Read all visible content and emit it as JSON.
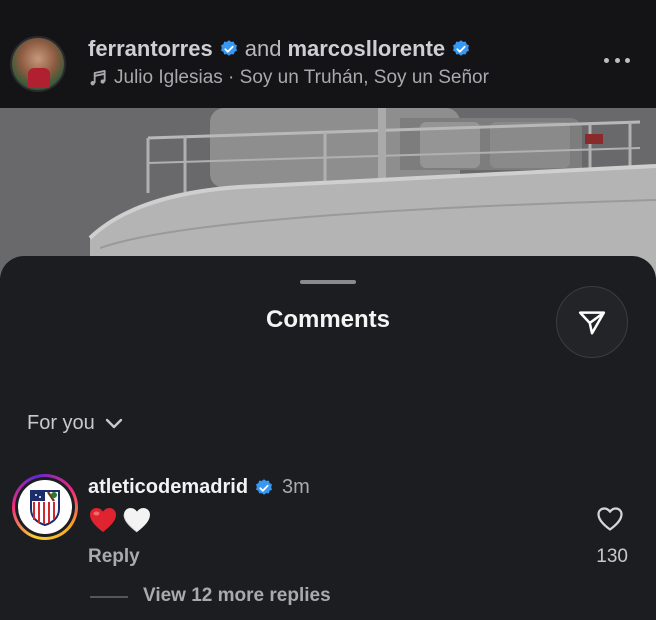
{
  "post": {
    "author1": "ferrantorres",
    "connector": "and",
    "author2": "marcosllorente",
    "music": "Julio Iglesias · Soy un Truhán, Soy un Señor"
  },
  "comments_sheet": {
    "title": "Comments",
    "filter_label": "For you"
  },
  "comments": [
    {
      "username": "atleticodemadrid",
      "time": "3m",
      "text": "❤️🤍",
      "reply_label": "Reply",
      "like_count": "130",
      "view_replies": "View 12 more replies"
    }
  ],
  "icons": {
    "verified": "verified-badge-icon",
    "music": "music-note-icon",
    "more": "more-options-icon",
    "share": "send-icon",
    "chevron": "chevron-down-icon",
    "like": "heart-outline-icon"
  },
  "colors": {
    "background": "#141416",
    "sheet": "#1c1d21",
    "verified_blue": "#3897f0",
    "emoji_red": "#e0242f"
  }
}
